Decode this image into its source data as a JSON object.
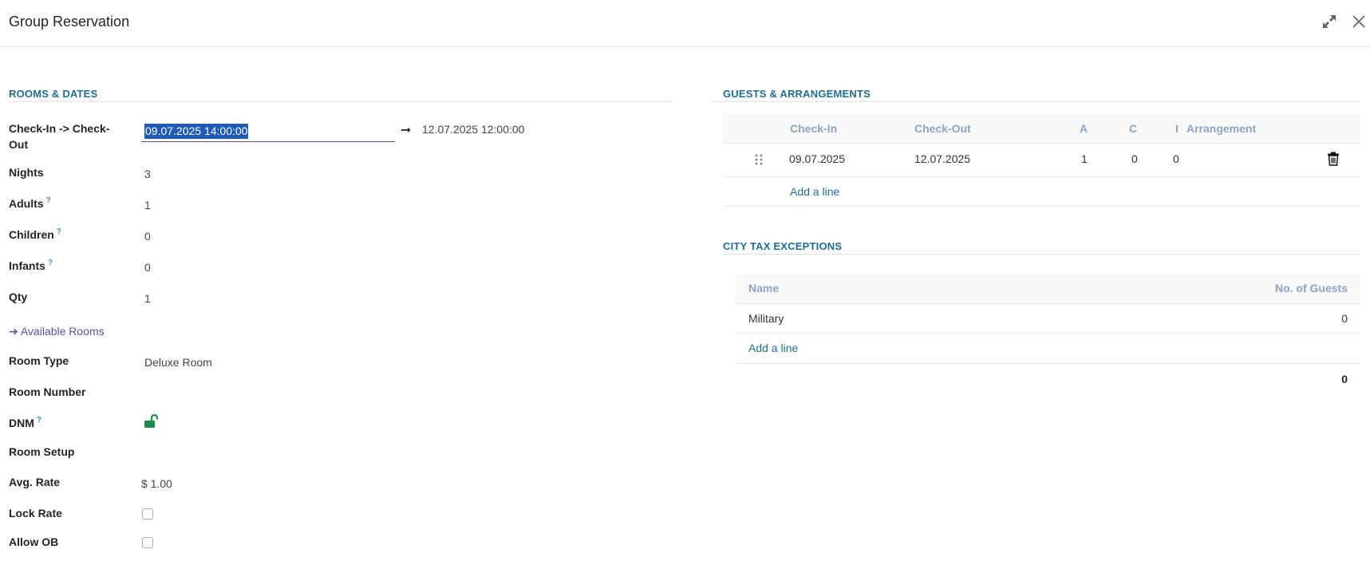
{
  "window": {
    "title": "Group Reservation"
  },
  "rooms_dates": {
    "section_title": "ROOMS & DATES",
    "checkin_checkout_label": "Check-In -> Check-Out",
    "checkin_value": "09.07.2025 14:00:00",
    "checkout_value": "12.07.2025 12:00:00",
    "nights_label": "Nights",
    "nights_value": "3",
    "adults_label": "Adults",
    "adults_value": "1",
    "children_label": "Children",
    "children_value": "0",
    "infants_label": "Infants",
    "infants_value": "0",
    "qty_label": "Qty",
    "qty_value": "1",
    "available_rooms_link": "➔ Available Rooms",
    "room_type_label": "Room Type",
    "room_type_value": "Deluxe Room",
    "room_number_label": "Room Number",
    "dnm_label": "DNM",
    "room_setup_label": "Room Setup",
    "avg_rate_label": "Avg. Rate",
    "avg_rate_value": "$ 1.00",
    "lock_rate_label": "Lock Rate",
    "allow_ob_label": "Allow OB",
    "help_mark": "?"
  },
  "guests": {
    "section_title": "GUESTS & ARRANGEMENTS",
    "columns": [
      "Check-In",
      "Check-Out",
      "A",
      "C",
      "I",
      "Arrangement"
    ],
    "rows": [
      {
        "checkin": "09.07.2025",
        "checkout": "12.07.2025",
        "a": "1",
        "c": "0",
        "i": "0",
        "arrangement": ""
      }
    ],
    "add_line": "Add a line"
  },
  "city_tax": {
    "section_title": "CITY TAX EXCEPTIONS",
    "columns": [
      "Name",
      "No. of Guests"
    ],
    "rows": [
      {
        "name": "Military",
        "guests": "0"
      }
    ],
    "add_line": "Add a line",
    "total": "0"
  },
  "colors": {
    "section_title": "#1f6f93",
    "selection": "#1f5ab4",
    "link": "#5a4fa0",
    "lock_green": "#1e8a4c"
  }
}
